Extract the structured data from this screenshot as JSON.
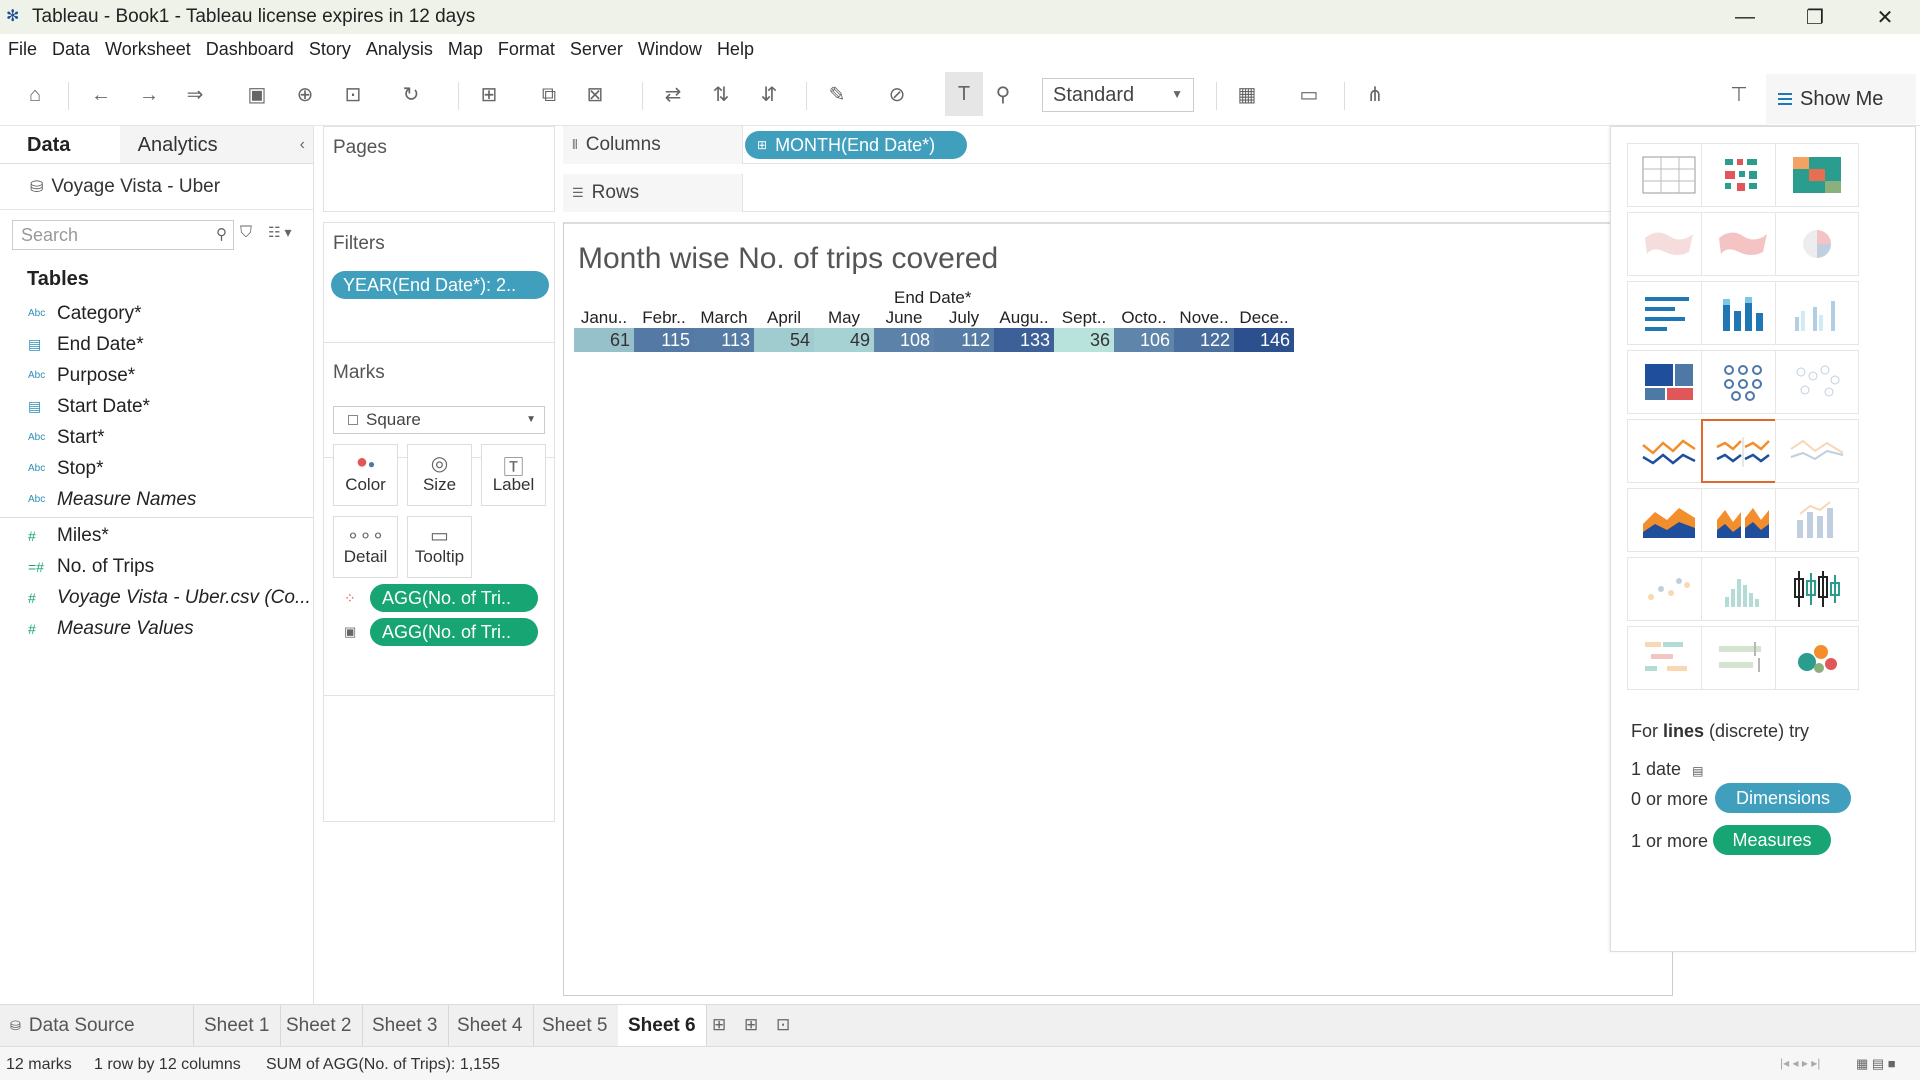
{
  "window": {
    "title": "Tableau - Book1 - Tableau license expires in 12 days",
    "minimize": "—",
    "restore": "❐",
    "close": "✕"
  },
  "menu": [
    "File",
    "Data",
    "Worksheet",
    "Dashboard",
    "Story",
    "Analysis",
    "Map",
    "Format",
    "Server",
    "Window",
    "Help"
  ],
  "toolbar": {
    "fit_mode": "Standard",
    "show_me_label": "Show Me"
  },
  "data_pane": {
    "tab_data": "Data",
    "tab_analytics": "Analytics",
    "datasource": "Voyage Vista - Uber",
    "search_placeholder": "Search",
    "tables_heading": "Tables",
    "dimensions": [
      {
        "type": "Abc",
        "name": "Category*"
      },
      {
        "type": "date",
        "name": "End Date*"
      },
      {
        "type": "Abc",
        "name": "Purpose*"
      },
      {
        "type": "date",
        "name": "Start Date*"
      },
      {
        "type": "Abc",
        "name": "Start*"
      },
      {
        "type": "Abc",
        "name": "Stop*"
      },
      {
        "type": "Abc",
        "name": "Measure Names"
      }
    ],
    "measures": [
      {
        "type": "#",
        "name": "Miles*"
      },
      {
        "type": "calc",
        "name": "No. of Trips"
      },
      {
        "type": "#",
        "name": "Voyage Vista - Uber.csv (Co..."
      },
      {
        "type": "#",
        "name": "Measure Values"
      }
    ]
  },
  "cards": {
    "pages": "Pages",
    "filters": "Filters",
    "filter_pill": "YEAR(End Date*): 2..",
    "marks": "Marks",
    "mark_type": "Square",
    "mark_buttons": [
      "Color",
      "Size",
      "Label",
      "Detail",
      "Tooltip"
    ],
    "mark_pills": [
      "AGG(No. of Tri..",
      "AGG(No. of Tri.."
    ]
  },
  "shelves": {
    "columns_label": "Columns",
    "columns_pill": "MONTH(End Date*)",
    "rows_label": "Rows"
  },
  "view": {
    "sheet_title": "Month wise No. of trips covered",
    "column_field": "End Date*"
  },
  "chart_data": {
    "type": "heatmap",
    "title": "Month wise No. of trips covered",
    "xlabel": "End Date*",
    "categories": [
      "Janu..",
      "Febr..",
      "March",
      "April",
      "May",
      "June",
      "July",
      "Augu..",
      "Sept..",
      "Octo..",
      "Nove..",
      "Dece.."
    ],
    "values": [
      61,
      115,
      113,
      54,
      49,
      108,
      112,
      133,
      36,
      106,
      122,
      146
    ],
    "color_range": [
      "#b7e3dc",
      "#2c4f8e"
    ]
  },
  "show_me": {
    "hint_prefix": "For ",
    "hint_bold": "lines",
    "hint_suffix": " (discrete) try",
    "req1": "1 date",
    "req2": "0 or more",
    "req2_pill": "Dimensions",
    "req3": "1 or more",
    "req3_pill": "Measures",
    "accent_dimension": "#3f9fbd",
    "accent_measure": "#16a573",
    "selected_border": "#e2672a"
  },
  "sheet_tabs": [
    "Data Source",
    "Sheet 1",
    "Sheet 2",
    "Sheet 3",
    "Sheet 4",
    "Sheet 5",
    "Sheet 6"
  ],
  "status": {
    "marks": "12 marks",
    "dims": "1 row by 12 columns",
    "sum": "SUM of AGG(No. of Trips): 1,155"
  }
}
